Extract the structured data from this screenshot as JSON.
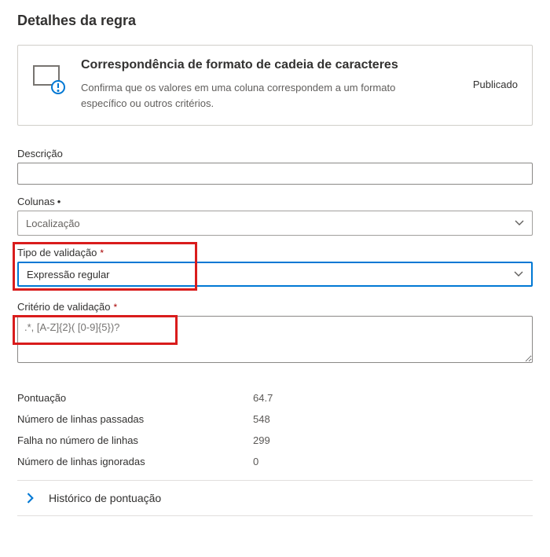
{
  "page_title": "Detalhes da regra",
  "card": {
    "title": "Correspondência de formato de cadeia de caracteres",
    "description": "Confirma que os valores em uma coluna correspondem a um formato específico ou outros critérios.",
    "status": "Publicado"
  },
  "fields": {
    "description_label": "Descrição",
    "description_value": "",
    "columns_label": "Colunas",
    "columns_value": "Localização",
    "validation_type_label": "Tipo de validação",
    "validation_type_value": "Expressão regular",
    "criteria_label": "Critério de validação",
    "criteria_value": ".*, [A-Z]{2}( [0-9]{5})?"
  },
  "stats": {
    "score_label": "Pontuação",
    "score_value": "64.7",
    "passed_label": "Número de linhas passadas",
    "passed_value": "548",
    "failed_label": "Falha no número de linhas",
    "failed_value": "299",
    "ignored_label": "Número de linhas ignoradas",
    "ignored_value": "0"
  },
  "history_label": "Histórico de pontuação"
}
